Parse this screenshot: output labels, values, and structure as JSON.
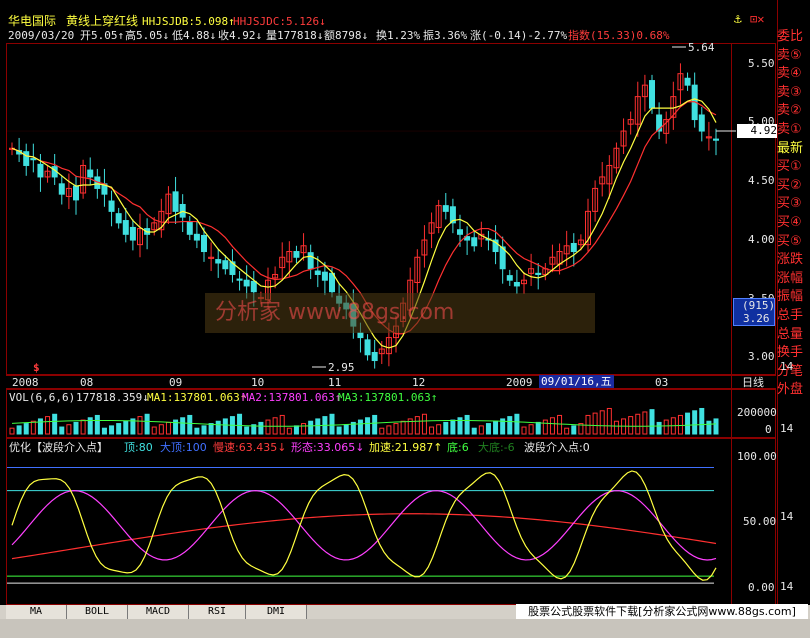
{
  "header": {
    "stock_name": "华电国际",
    "indicator_title": "黄线上穿红线",
    "hhjsjdb": "HHJSJDB:5.098↑",
    "hhjsjdc": "HHJSJDC:5.126↓",
    "date": "2009/03/20",
    "open": "开5.05↑",
    "high": "高5.05↓",
    "low": "低4.88↓",
    "close": "收4.92↓",
    "volume": "量177818↓",
    "amount": "额8798↓",
    "turnover": "换1.23%",
    "amplitude": "振3.36%",
    "change": "涨(-0.14)-2.77%",
    "index": "指数(15.33)0.68%"
  },
  "price_axis": {
    "ticks": [
      "5.50",
      "5.00",
      "4.50",
      "4.00",
      "3.50",
      "3.00"
    ],
    "current_price": "4.92",
    "high_label": "5.64",
    "low_label": "2.95",
    "volume_mark": "(915)",
    "volume_value": "3.26"
  },
  "time_axis": {
    "labels": [
      "2008",
      "08",
      "09",
      "10",
      "11",
      "12",
      "2009",
      "09/01/16,五",
      "03"
    ],
    "period": "日线"
  },
  "volume_panel": {
    "title": "VOL(6,6,6)",
    "vol": "177818.359↓",
    "ma1": "MA1:137801.063↑",
    "ma2": "MA2:137801.063↑",
    "ma3": "MA3:137801.063↑",
    "ticks": [
      "200000",
      "0"
    ]
  },
  "indicator_panel": {
    "title": "优化【波段介入点】",
    "top": "顶:80",
    "top_big": "大顶:100",
    "slow": "慢速:63.435↓",
    "shape": "形态:33.065↓",
    "fast": "加速:21.987↑",
    "bottom": "底:6",
    "bottom_big": "大底:-6",
    "entry": "波段介入点:0",
    "ticks": [
      "100.00",
      "50.00",
      "0.00"
    ]
  },
  "right_panel": {
    "items": [
      "委比",
      "卖⑤",
      "卖④",
      "卖③",
      "卖②",
      "卖①",
      "最新",
      "买①",
      "买②",
      "买③",
      "买④",
      "买⑤",
      "涨跌",
      "涨幅",
      "振幅",
      "总手",
      "总量",
      "换手",
      "分笔",
      "外盘"
    ],
    "side_nums": [
      "14",
      "14",
      "14",
      "14"
    ]
  },
  "tabs": [
    "MA",
    "BOLL",
    "MACD",
    "RSI",
    "DMI"
  ],
  "watermark": "分析家 www.88gs.com",
  "footnote": "股票公式股票软件下载[分析家公式网www.88gs.com]",
  "colors": {
    "up": "#ff3030",
    "down": "#40e0e0",
    "ma_yellow": "#ffff40",
    "ma_red": "#ff3030",
    "panel_border": "#8b0000"
  },
  "chart_data": {
    "type": "candlestick",
    "close": [
      4.85,
      4.8,
      4.7,
      4.75,
      4.6,
      4.65,
      4.6,
      4.45,
      4.5,
      4.4,
      4.7,
      4.6,
      4.5,
      4.45,
      4.3,
      4.2,
      4.1,
      4.05,
      4.15,
      4.1,
      4.2,
      4.3,
      4.45,
      4.3,
      4.25,
      4.1,
      4.05,
      3.95,
      3.9,
      3.85,
      3.8,
      3.75,
      3.7,
      3.65,
      3.6,
      3.55,
      3.7,
      3.75,
      3.9,
      3.95,
      3.9,
      4.0,
      3.8,
      3.75,
      3.7,
      3.6,
      3.5,
      3.45,
      3.3,
      3.2,
      3.05,
      3.0,
      3.1,
      3.2,
      3.3,
      3.5,
      3.7,
      3.9,
      4.05,
      4.2,
      4.35,
      4.3,
      4.2,
      4.1,
      4.05,
      4.0,
      4.1,
      4.05,
      3.95,
      3.8,
      3.7,
      3.65,
      3.7,
      3.8,
      3.75,
      3.8,
      3.9,
      3.95,
      4.0,
      3.95,
      4.05,
      4.3,
      4.5,
      4.6,
      4.7,
      4.85,
      5.0,
      5.1,
      5.3,
      5.4,
      5.2,
      5.0,
      5.1,
      5.3,
      5.5,
      5.4,
      5.1,
      5.0,
      4.95,
      4.92
    ],
    "yellow_ma_last": 5.098,
    "red_ma_last": 5.126,
    "ylim": [
      2.9,
      5.75
    ],
    "volume_ylim": [
      0,
      300000
    ],
    "indicator_ylim": [
      -6,
      110
    ]
  }
}
